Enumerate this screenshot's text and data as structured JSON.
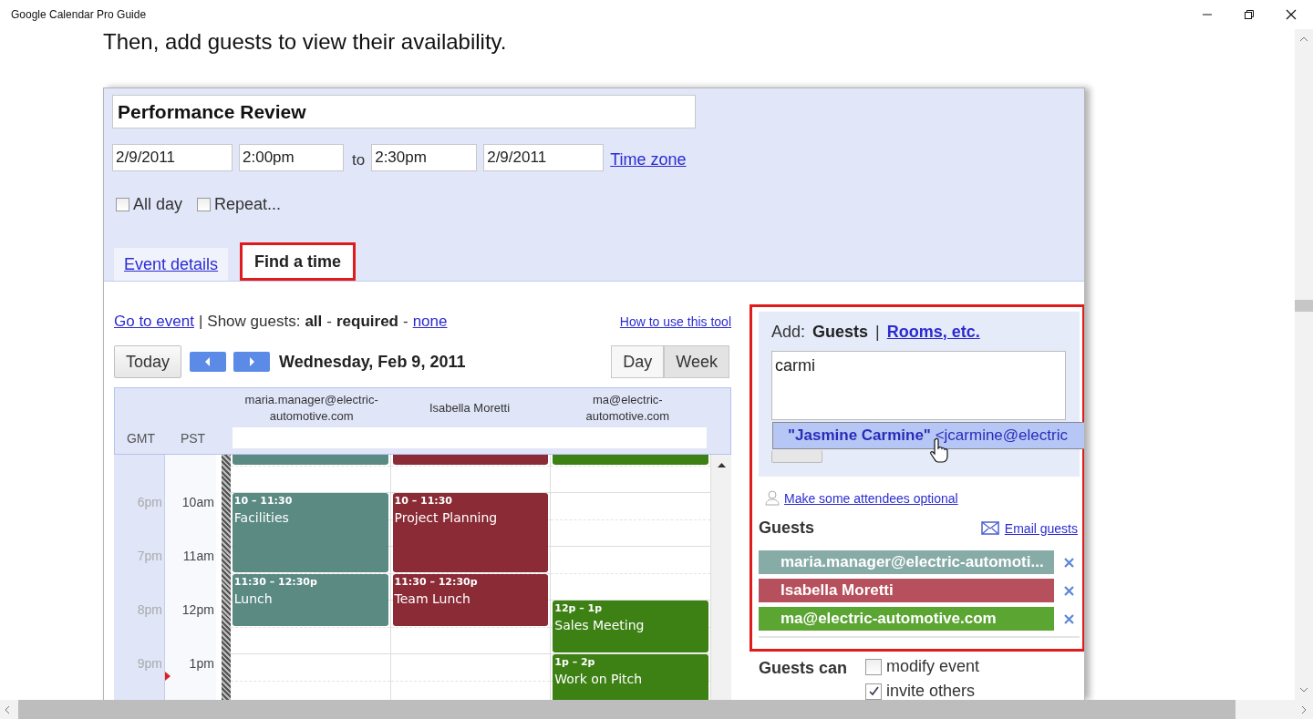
{
  "window": {
    "title": "Google Calendar Pro Guide"
  },
  "instruction": "Then, add guests to view their availability.",
  "event": {
    "title": "Performance Review",
    "start_date": "2/9/2011",
    "start_time": "2:00pm",
    "to_label": "to",
    "end_time": "2:30pm",
    "end_date": "2/9/2011",
    "time_zone_link": "Time zone",
    "options": [
      {
        "label": "All day",
        "checked": false
      },
      {
        "label": "Repeat...",
        "checked": false
      }
    ]
  },
  "tabs": [
    {
      "label": "Event details",
      "selected": false,
      "highlighted": false
    },
    {
      "label": "Find a time",
      "selected": true,
      "highlighted": true
    }
  ],
  "find_a_time": {
    "go_to_event": "Go to event",
    "separator": "|",
    "show_guests_label": "Show guests:",
    "option_separator": "-",
    "show_guests_options": [
      {
        "label": "all",
        "selected": true
      },
      {
        "label": "required",
        "selected": true
      },
      {
        "label": "none",
        "selected": false
      }
    ],
    "help_link": "How to use this tool",
    "today_button": "Today",
    "date_label": "Wednesday, Feb 9, 2011",
    "views": [
      {
        "label": "Day",
        "selected": true
      },
      {
        "label": "Week",
        "selected": false
      }
    ]
  },
  "calendar": {
    "timezones": [
      "GMT",
      "PST"
    ],
    "hours": [
      {
        "gmt": "6pm",
        "pst": "10am"
      },
      {
        "gmt": "7pm",
        "pst": "11am"
      },
      {
        "gmt": "8pm",
        "pst": "12pm"
      },
      {
        "gmt": "9pm",
        "pst": "1pm"
      }
    ],
    "columns": [
      {
        "guest": "maria.manager@electric-automotive.com",
        "color": "#5b8a83",
        "events": [
          {
            "kind": "clipped"
          },
          {
            "kind": "event",
            "time": "10 – 11:30",
            "title": "Facilities"
          },
          {
            "kind": "event",
            "time": "11:30 – 12:30p",
            "title": "Lunch"
          }
        ]
      },
      {
        "guest": "Isabella Moretti",
        "color": "#8a2b36",
        "events": [
          {
            "kind": "clipped"
          },
          {
            "kind": "event",
            "time": "10 – 11:30",
            "title": "Project Planning"
          },
          {
            "kind": "event",
            "time": "11:30 – 12:30p",
            "title": "Team Lunch"
          }
        ]
      },
      {
        "guest": "ma@electric-automotive.com",
        "color": "#3d8014",
        "events": [
          {
            "kind": "clipped"
          },
          {
            "kind": "event",
            "time": "12p – 1p",
            "title": "Sales Meeting"
          },
          {
            "kind": "event",
            "time": "1p – 2p",
            "title": "Work on Pitch"
          }
        ]
      }
    ]
  },
  "guests_panel": {
    "highlighted": true,
    "add_label": "Add:",
    "separator": "|",
    "add_tabs": [
      {
        "label": "Guests",
        "selected": true
      },
      {
        "label": "Rooms, etc.",
        "selected": false
      }
    ],
    "guest_input": "carmi",
    "suggestion": "**\"Jasmine Carmine\"** <jcarmine@electric",
    "optional_link": "Make some attendees optional",
    "guests_heading": "Guests",
    "email_link": "Email guests",
    "guests": [
      {
        "name": "maria.manager@electric-automoti...",
        "color": "#87aba6"
      },
      {
        "name": "Isabella Moretti",
        "color": "#b5505c"
      },
      {
        "name": "ma@electric-automotive.com",
        "color": "#5ba532"
      }
    ],
    "permissions_label": "Guests can",
    "permissions": [
      {
        "label": "modify event",
        "checked": false
      },
      {
        "label": "invite others",
        "checked": true
      }
    ]
  }
}
